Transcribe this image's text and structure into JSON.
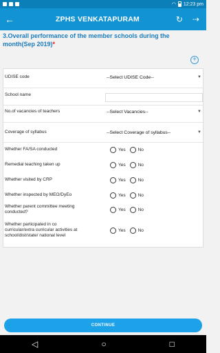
{
  "status": {
    "time": "12:23 pm"
  },
  "app": {
    "title": "ZPHS VENKATAPURAM"
  },
  "question": {
    "text": "3.Overall performance of the member schools during the month(Sep 2019)",
    "required_mark": "*"
  },
  "form": {
    "udise_label": "UDISE code",
    "udise_value": "--Select UDISE Code--",
    "school_label": "School name",
    "vacancy_label": "No.of vacancies of teachers",
    "vacancy_value": "--Select Vacancies--",
    "syllabus_label": "Coverage of syllabus",
    "syllabus_value": "--Select Coverage of syllabus--",
    "yes": "Yes",
    "no": "No",
    "questions": [
      "Whether FA/SA conducted",
      "Remedial teaching taken up",
      "Whether visited by CRP",
      "Whether inspected by MEO/DyEo",
      "Whether parent committee meeting conducted?",
      "Whether participated in co curricular/extra curricular activities at school/dist/state/ national level"
    ]
  },
  "continue_label": "CONTINUE"
}
